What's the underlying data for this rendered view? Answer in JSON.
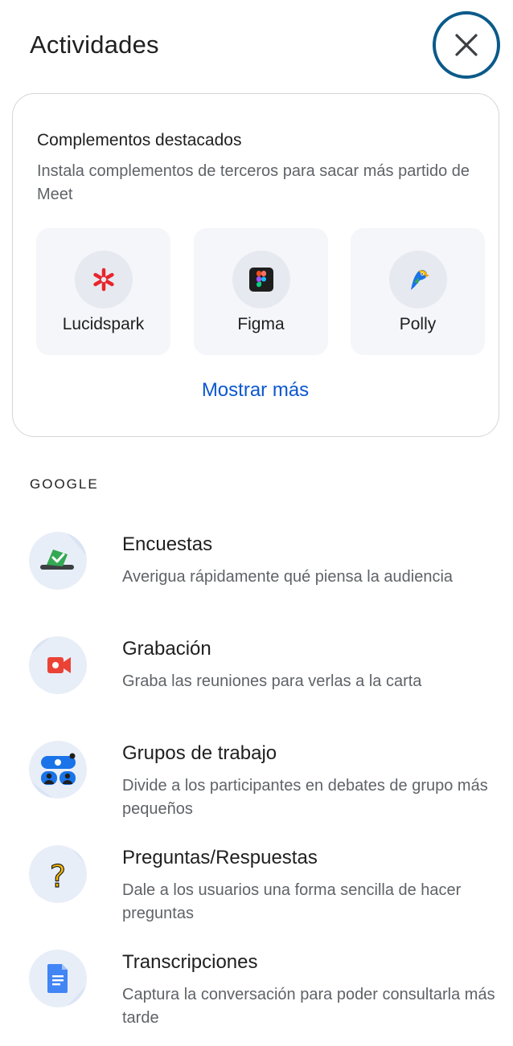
{
  "header": {
    "title": "Actividades"
  },
  "featured": {
    "title": "Complementos destacados",
    "description": "Instala complementos de terceros para sacar más partido de Meet",
    "addons": [
      {
        "label": "Lucidspark",
        "icon": "lucidspark-logo-icon"
      },
      {
        "label": "Figma",
        "icon": "figma-logo-icon"
      },
      {
        "label": "Polly",
        "icon": "polly-logo-icon"
      }
    ],
    "show_more": "Mostrar más"
  },
  "google": {
    "section_label": "GOOGLE",
    "items": [
      {
        "title": "Encuestas",
        "description": "Averigua rápidamente qué piensa la audiencia",
        "icon": "polls-icon"
      },
      {
        "title": "Grabación",
        "description": "Graba las reuniones para verlas a la carta",
        "icon": "recording-icon"
      },
      {
        "title": "Grupos de trabajo",
        "description": "Divide a los participantes en debates de grupo más pequeños",
        "icon": "breakout-rooms-icon"
      },
      {
        "title": "Preguntas/Respuestas",
        "description": "Dale a los usuarios una forma sencilla de hacer preguntas",
        "icon": "qa-icon"
      },
      {
        "title": "Transcripciones",
        "description": "Captura la conversación para poder consultarla más tarde",
        "icon": "transcripts-icon"
      }
    ]
  },
  "colors": {
    "accent": "#0b57d0",
    "focus_ring": "#0b5a8a",
    "card_border": "#d3d6db"
  }
}
